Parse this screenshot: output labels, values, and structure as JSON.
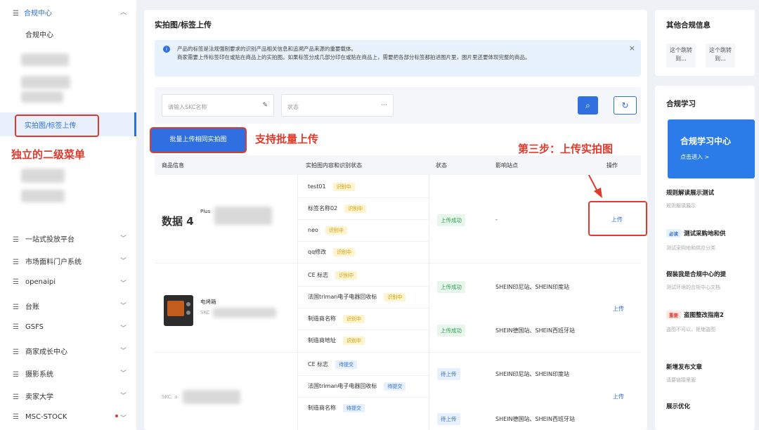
{
  "sidebar": {
    "header": "合规中心",
    "sub_item": "合规中心",
    "active_item": "实拍图/标签上传",
    "items": [
      {
        "label": "一站式投放平台",
        "dot": false
      },
      {
        "label": "市场面料门户系统",
        "dot": false
      },
      {
        "label": "openaipi",
        "dot": false
      },
      {
        "label": "台账",
        "dot": false
      },
      {
        "label": "GSFS",
        "dot": false
      },
      {
        "label": "商家成长中心",
        "dot": false
      },
      {
        "label": "摄影系统",
        "dot": false
      },
      {
        "label": "卖家大学",
        "dot": false
      },
      {
        "label": "MSC-STOCK",
        "dot": true
      }
    ]
  },
  "annotations": {
    "menu": "独立的二级菜单",
    "bulk": "支持批量上传",
    "step3": "第三步：上传实拍图"
  },
  "main": {
    "title": "实拍图/标签上传",
    "notice": "产品的标签是法规强制要求的识别产品相关信息和追溯产品来源的重要载体。\n商家需要上传标签印在或贴在商品上的实拍图。如果标签分成几部分印在或贴在商品上，需要把各部分标签都拍进图片里，图片里还要体现完整的商品。",
    "filters": {
      "skc_placeholder": "请输入SKC名称",
      "status_placeholder": "状态"
    },
    "bulk_button": "批量上传相同实拍图",
    "columns": [
      "商品信息",
      "实拍图内容和识别状态",
      "状态",
      "影响站点",
      "操作"
    ],
    "rows": [
      {
        "product_name": "数据 4",
        "product_code": "Plus",
        "items": [
          {
            "name": "test01",
            "tag": "识别中"
          },
          {
            "name": "标签名称02",
            "tag": "识别中"
          },
          {
            "name": "neo",
            "tag": "识别中"
          },
          {
            "name": "qq修改",
            "tag": "识别中"
          }
        ],
        "status": "上传成功",
        "sites": "-",
        "action": "上传"
      },
      {
        "product_name": "电烤箱",
        "product_code": "SKC",
        "items": [
          {
            "name": "CE 标志",
            "tag": "识别中"
          },
          {
            "name": "法国triman电子电器回收标",
            "tag": "识别中"
          },
          {
            "name": "制造商名称",
            "tag": "识别中"
          },
          {
            "name": "制造商地址",
            "tag": "识别中"
          }
        ],
        "status_1": "上传成功",
        "sites_1": "SHEIN印尼站、SHEIN印度站",
        "status_2": "上传成功",
        "sites_2": "SHEIN德国站、SHEIN西班牙站",
        "action": "上传"
      },
      {
        "product_code": "SKC: a",
        "items": [
          {
            "name": "CE 标志",
            "tag": "待提交"
          },
          {
            "name": "法国triman电子电器回收标",
            "tag": "待提交"
          },
          {
            "name": "制造商名称",
            "tag": "待提交"
          }
        ],
        "status_1": "待上传",
        "sites_1": "SHEIN印尼站、SHEIN印度站",
        "status_2": "待上传",
        "sites_2": "SHEIN德国站、SHEIN西班牙站",
        "action": "上传"
      }
    ]
  },
  "right_panel": {
    "other_title": "其他合规信息",
    "jumps": [
      "这个跳转到...",
      "这个跳转到..."
    ],
    "learn_title": "合规学习",
    "banner_title": "合规学习中心",
    "banner_sub": "点击进入 >",
    "entries": [
      {
        "title": "规则解读展示测试",
        "sub": "规则解读展示",
        "badge": ""
      },
      {
        "title": "测试采购地和供",
        "sub": "测试采购地和供应分类",
        "badge": "必读"
      },
      {
        "title": "假装我是合规中心的提",
        "sub": "测试环境的合规中心文档",
        "badge": ""
      },
      {
        "title": "盗图整改指南2",
        "sub": "盗图不可以，拒绝盗图",
        "badge": "重要"
      },
      {
        "title": "新增发布文章",
        "sub": "请要链接里面",
        "badge": ""
      },
      {
        "title": "展示优化",
        "sub": "",
        "badge": ""
      }
    ]
  }
}
